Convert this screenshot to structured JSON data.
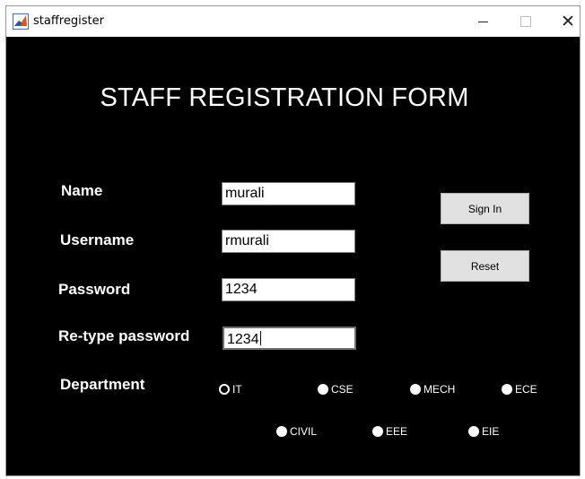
{
  "window": {
    "title": "staffregister",
    "background": "#000000"
  },
  "form": {
    "title": "STAFF REGISTRATION FORM",
    "labels": {
      "name": "Name",
      "username": "Username",
      "password": "Password",
      "retype": "Re-type password",
      "department": "Department"
    },
    "fields": {
      "name": "murali",
      "username": "rmurali",
      "password": "1234",
      "retype": "1234"
    },
    "buttons": {
      "sign_in": "Sign In",
      "reset": "Reset"
    },
    "departments": [
      {
        "label": "IT",
        "selected": true
      },
      {
        "label": "CSE",
        "selected": false
      },
      {
        "label": "MECH",
        "selected": false
      },
      {
        "label": "ECE",
        "selected": false
      },
      {
        "label": "CIVIL",
        "selected": false
      },
      {
        "label": "EEE",
        "selected": false
      },
      {
        "label": "EIE",
        "selected": false
      }
    ]
  }
}
